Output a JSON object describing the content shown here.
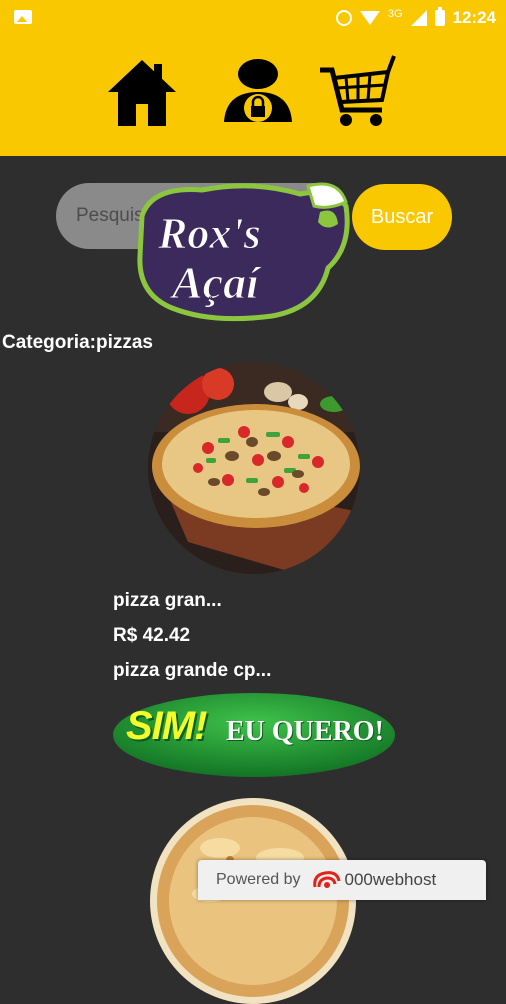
{
  "status_bar": {
    "network": "3G",
    "time": "12:24",
    "icons": [
      "image-notification-icon",
      "alarm-icon",
      "wifi-icon",
      "cell-signal-icon",
      "battery-icon"
    ]
  },
  "header": {
    "nav": [
      {
        "icon": "home-icon"
      },
      {
        "icon": "user-lock-icon"
      },
      {
        "icon": "shopping-cart-icon"
      }
    ],
    "background_color": "#f9c800"
  },
  "search": {
    "placeholder": "Pesquisar ...",
    "value": "",
    "button_label": "Buscar"
  },
  "logo": {
    "text_line1": "Rox's",
    "text_line2": "Açaí"
  },
  "category_label": "Categoria:pizzas",
  "products": [
    {
      "name": "pizza gran...",
      "price": "R$ 42.42",
      "description": "pizza grande cp...",
      "cta_sim": "SIM!",
      "cta_eu": "EU QUERO!"
    }
  ],
  "footer_badge": {
    "prefix": "Powered by",
    "brand": "000webhost"
  },
  "colors": {
    "accent": "#f9c800",
    "background": "#2e2e2e",
    "cta_green": "#1d8a2c"
  }
}
